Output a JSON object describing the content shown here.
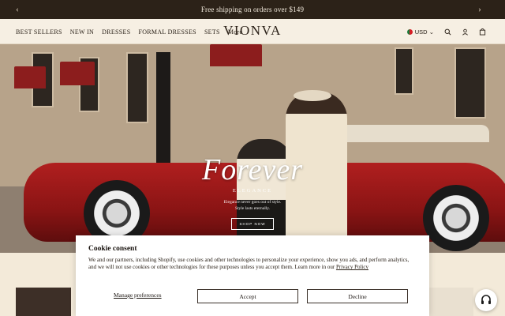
{
  "announcement": {
    "text": "Free shipping on orders over $149"
  },
  "header": {
    "nav": [
      "BEST SELLERS",
      "NEW IN",
      "DRESSES",
      "FORMAL DRESSES",
      "SETS",
      "More"
    ],
    "logo": "VIONVA",
    "currency": "USD"
  },
  "hero": {
    "title": "Forever",
    "subtitle": "ELEGANCE",
    "tagline_1": "Elegance never goes out of style.",
    "tagline_2": "Style lasts eternally.",
    "cta": "SHOP NOW"
  },
  "cookie": {
    "title": "Cookie consent",
    "body": "We and our partners, including Shopify, use cookies and other technologies to personalize your experience, show you ads, and perform analytics, and we will not use cookies or other technologies for these purposes unless you accept them. Learn more in our",
    "policy_link": "Privacy Policy",
    "manage": "Manage preferences",
    "accept": "Accept",
    "decline": "Decline"
  },
  "icons": {
    "prev": "chevron-left-icon",
    "next": "chevron-right-icon",
    "search": "search-icon",
    "account": "user-icon",
    "cart": "bag-icon",
    "help": "headset-icon"
  },
  "colors": {
    "announcement_bg": "#2c2218",
    "header_bg": "#f6efe3",
    "car_red": "#a01b1b"
  }
}
